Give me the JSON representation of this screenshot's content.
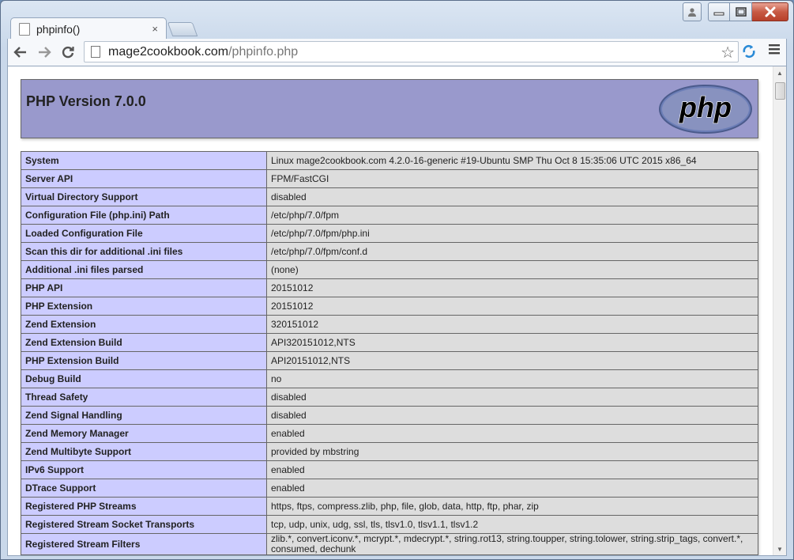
{
  "window": {
    "user_icon": "user-icon",
    "minimize_icon": "minimize-icon",
    "maximize_icon": "maximize-icon",
    "close_icon": "close-icon"
  },
  "tab": {
    "title": "phpinfo()",
    "close": "×"
  },
  "toolbar": {
    "url_host": "mage2cookbook.com",
    "url_path": "/phpinfo.php",
    "icons": [
      "back-arrow-icon",
      "forward-arrow-icon",
      "reload-icon",
      "page-icon",
      "bookmark-star-icon",
      "sync-extension-icon",
      "menu-icon"
    ]
  },
  "page": {
    "heading": "PHP Version 7.0.0",
    "logo_text": "php",
    "rows": [
      {
        "key": "System",
        "value": "Linux mage2cookbook.com 4.2.0-16-generic #19-Ubuntu SMP Thu Oct 8 15:35:06 UTC 2015 x86_64"
      },
      {
        "key": "Server API",
        "value": "FPM/FastCGI"
      },
      {
        "key": "Virtual Directory Support",
        "value": "disabled"
      },
      {
        "key": "Configuration File (php.ini) Path",
        "value": "/etc/php/7.0/fpm"
      },
      {
        "key": "Loaded Configuration File",
        "value": "/etc/php/7.0/fpm/php.ini"
      },
      {
        "key": "Scan this dir for additional .ini files",
        "value": "/etc/php/7.0/fpm/conf.d"
      },
      {
        "key": "Additional .ini files parsed",
        "value": "(none)"
      },
      {
        "key": "PHP API",
        "value": "20151012"
      },
      {
        "key": "PHP Extension",
        "value": "20151012"
      },
      {
        "key": "Zend Extension",
        "value": "320151012"
      },
      {
        "key": "Zend Extension Build",
        "value": "API320151012,NTS"
      },
      {
        "key": "PHP Extension Build",
        "value": "API20151012,NTS"
      },
      {
        "key": "Debug Build",
        "value": "no"
      },
      {
        "key": "Thread Safety",
        "value": "disabled"
      },
      {
        "key": "Zend Signal Handling",
        "value": "disabled"
      },
      {
        "key": "Zend Memory Manager",
        "value": "enabled"
      },
      {
        "key": "Zend Multibyte Support",
        "value": "provided by mbstring"
      },
      {
        "key": "IPv6 Support",
        "value": "enabled"
      },
      {
        "key": "DTrace Support",
        "value": "enabled"
      },
      {
        "key": "Registered PHP Streams",
        "value": "https, ftps, compress.zlib, php, file, glob, data, http, ftp, phar, zip"
      },
      {
        "key": "Registered Stream Socket Transports",
        "value": "tcp, udp, unix, udg, ssl, tls, tlsv1.0, tlsv1.1, tlsv1.2"
      },
      {
        "key": "Registered Stream Filters",
        "value": "zlib.*, convert.iconv.*, mcrypt.*, mdecrypt.*, string.rot13, string.toupper, string.tolower, string.strip_tags, convert.*, consumed, dechunk"
      }
    ]
  }
}
